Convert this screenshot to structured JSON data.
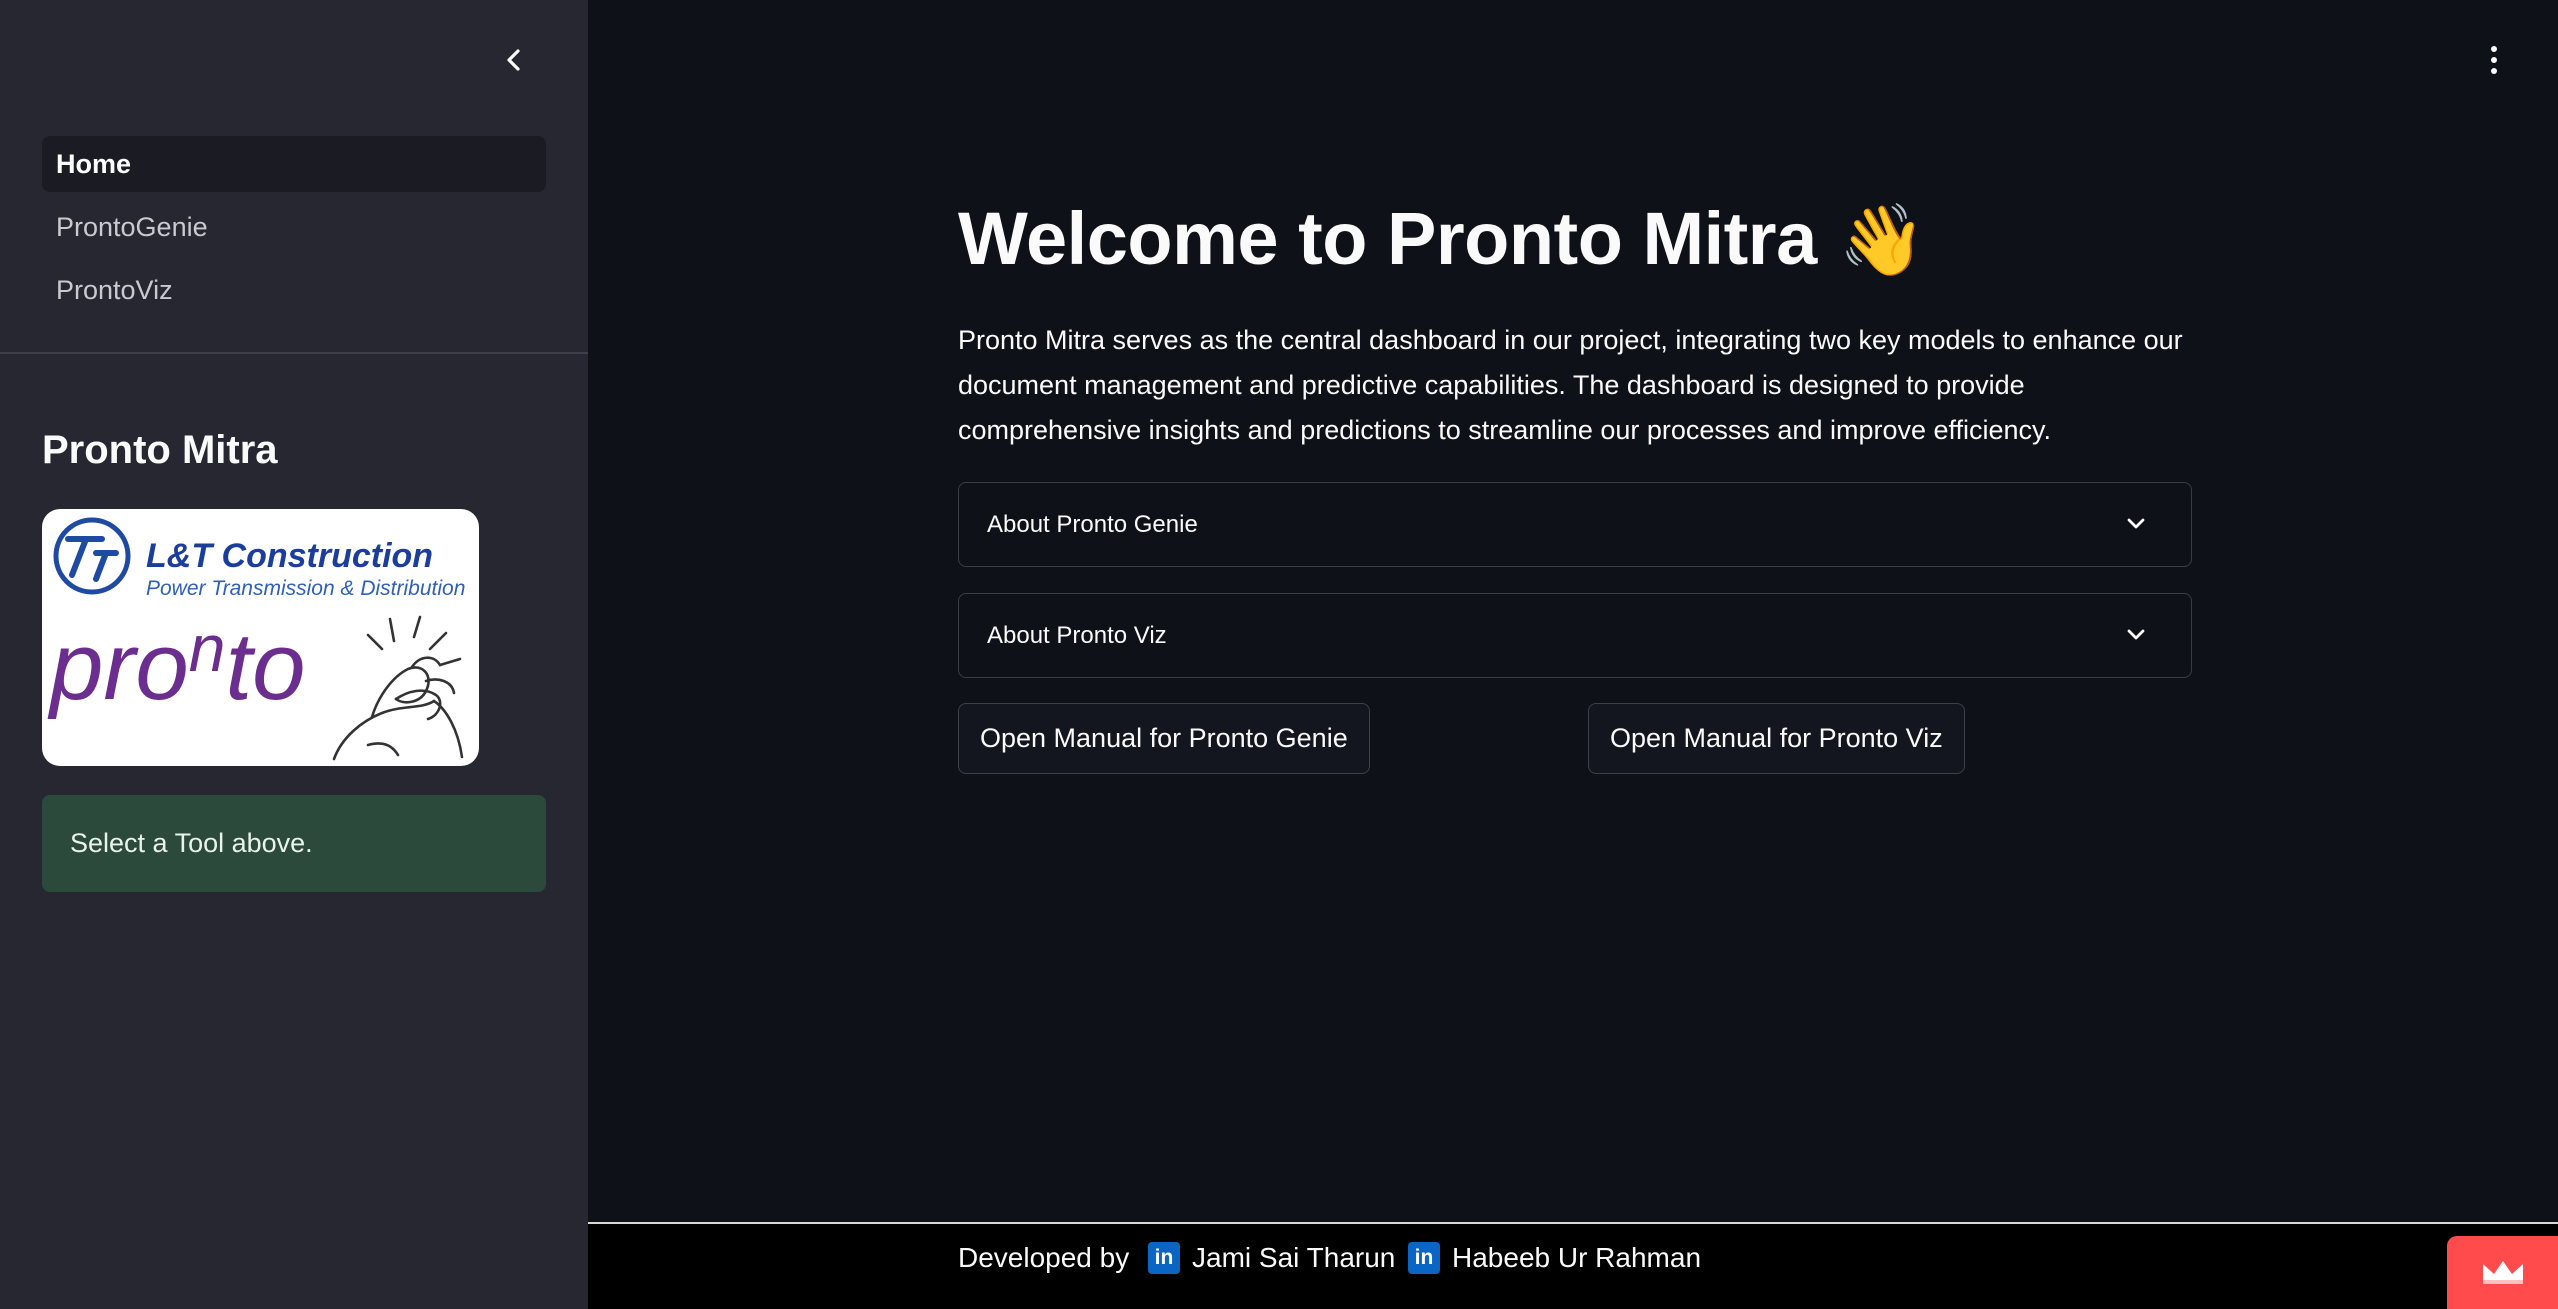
{
  "sidebar": {
    "nav": [
      {
        "label": "Home",
        "active": true
      },
      {
        "label": "ProntoGenie",
        "active": false
      },
      {
        "label": "ProntoViz",
        "active": false
      }
    ],
    "title": "Pronto Mitra",
    "logo": {
      "brand_line1": "L&T Construction",
      "brand_line2": "Power Transmission & Distribution",
      "wordmark_a": "pro",
      "wordmark_b": "n",
      "wordmark_c": "to"
    },
    "info_message": "Select a Tool above."
  },
  "main": {
    "title": "Welcome to Pronto Mitra",
    "title_emoji": "👋",
    "description": "Pronto Mitra serves as the central dashboard in our project, integrating two key models to enhance our document management and predictive capabilities. The dashboard is designed to provide comprehensive insights and predictions to streamline our processes and improve efficiency.",
    "expanders": [
      {
        "label": "About Pronto Genie"
      },
      {
        "label": "About Pronto Viz"
      }
    ],
    "buttons": [
      {
        "label": "Open Manual for Pronto Genie"
      },
      {
        "label": "Open Manual for Pronto Viz"
      }
    ]
  },
  "footer": {
    "developed_by": "Developed by",
    "developers": [
      {
        "name": "Jami Sai Tharun",
        "icon": "linkedin-icon"
      },
      {
        "name": "Habeeb Ur Rahman",
        "icon": "linkedin-icon"
      }
    ]
  },
  "colors": {
    "background": "#0e1117",
    "sidebar": "#262730",
    "info_box": "#2b4a3b",
    "accent_badge": "#ff4b4b",
    "linkedin": "#0a66c2"
  }
}
